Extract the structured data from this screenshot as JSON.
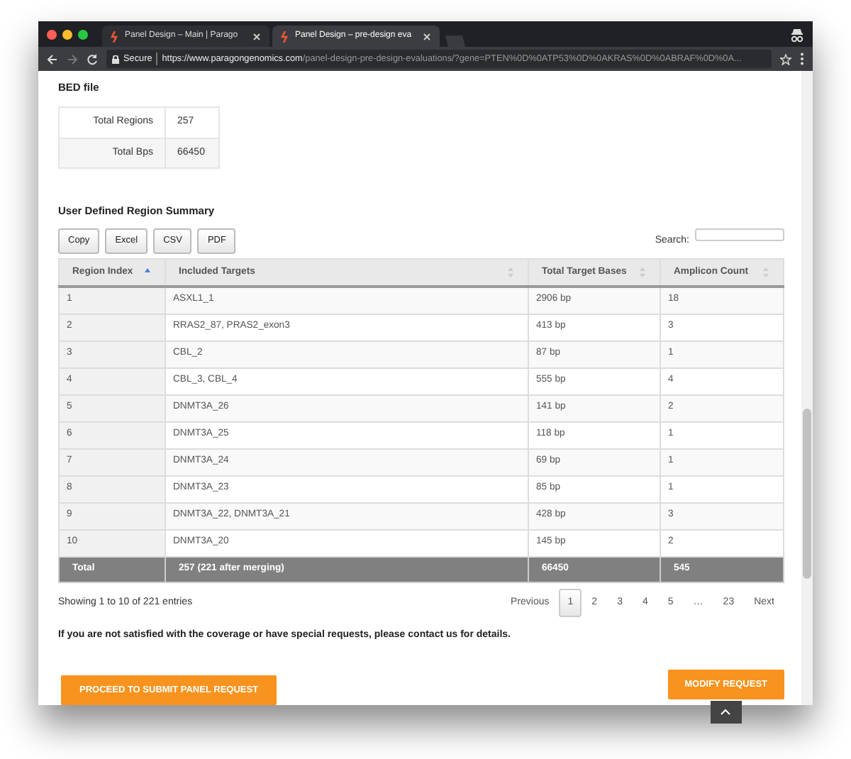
{
  "browser": {
    "tabs": [
      {
        "title": "Panel Design – Main | Parago",
        "selected": false
      },
      {
        "title": "Panel Design – pre-design eva",
        "selected": true
      }
    ],
    "address": {
      "secure_label": "Secure",
      "url_host": "https://www.paragongenomics.com",
      "url_path": "/panel-design-pre-design-evaluations/?gene=PTEN%0D%0ATP53%0D%0AKRAS%0D%0ABRAF%0D%0A..."
    }
  },
  "bed_file": {
    "title": "BED file",
    "rows": [
      {
        "label": "Total Regions",
        "value": "257"
      },
      {
        "label": "Total Bps",
        "value": "66450"
      }
    ]
  },
  "summary": {
    "title": "User Defined Region Summary",
    "export_buttons": [
      "Copy",
      "Excel",
      "CSV",
      "PDF"
    ],
    "search_label": "Search:",
    "table": {
      "columns": [
        {
          "label": "Region Index",
          "sorted": true
        },
        {
          "label": "Included Targets",
          "sorted": false
        },
        {
          "label": "Total Target Bases",
          "sorted": false
        },
        {
          "label": "Amplicon Count",
          "sorted": false
        }
      ],
      "rows": [
        [
          "1",
          "ASXL1_1",
          "2906 bp",
          "18"
        ],
        [
          "2",
          "RRAS2_87, PRAS2_exon3",
          "413 bp",
          "3"
        ],
        [
          "3",
          "CBL_2",
          "87 bp",
          "1"
        ],
        [
          "4",
          "CBL_3, CBL_4",
          "555 bp",
          "4"
        ],
        [
          "5",
          "DNMT3A_26",
          "141 bp",
          "2"
        ],
        [
          "6",
          "DNMT3A_25",
          "118 bp",
          "1"
        ],
        [
          "7",
          "DNMT3A_24",
          "69 bp",
          "1"
        ],
        [
          "8",
          "DNMT3A_23",
          "85 bp",
          "1"
        ],
        [
          "9",
          "DNMT3A_22, DNMT3A_21",
          "428 bp",
          "3"
        ],
        [
          "10",
          "DNMT3A_20",
          "145 bp",
          "2"
        ]
      ],
      "footer": [
        "Total",
        "257 (221 after merging)",
        "66450",
        "545"
      ]
    },
    "info": "Showing 1 to 10 of 221 entries",
    "pagination": {
      "previous": "Previous",
      "next": "Next",
      "pages": [
        {
          "label": "1",
          "selected": true
        },
        {
          "label": "2",
          "selected": false
        },
        {
          "label": "3",
          "selected": false
        },
        {
          "label": "4",
          "selected": false
        },
        {
          "label": "5",
          "selected": false
        },
        {
          "label": "…",
          "selected": false
        },
        {
          "label": "23",
          "selected": false
        }
      ]
    }
  },
  "notice": "If you are not satisfied with the coverage or have special requests, please contact us for details.",
  "actions": {
    "submit": "PROCEED TO SUBMIT PANEL REQUEST",
    "modify": "MODIFY REQUEST"
  }
}
